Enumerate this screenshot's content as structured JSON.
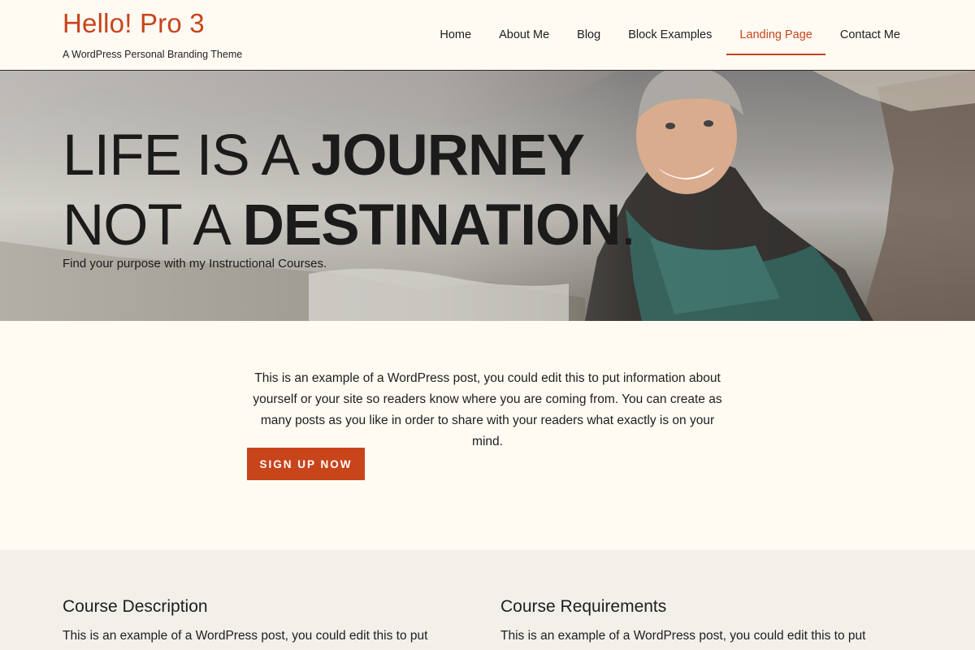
{
  "site": {
    "title": "Hello! Pro 3",
    "tagline": "A WordPress Personal Branding Theme"
  },
  "nav": {
    "items": [
      {
        "label": "Home",
        "active": false
      },
      {
        "label": "About Me",
        "active": false
      },
      {
        "label": "Blog",
        "active": false
      },
      {
        "label": "Block Examples",
        "active": false
      },
      {
        "label": "Landing Page",
        "active": true
      },
      {
        "label": "Contact Me",
        "active": false
      }
    ]
  },
  "hero": {
    "line1_light": "LIFE IS A ",
    "line1_bold": "JOURNEY",
    "line2_light": "NOT A ",
    "line2_bold": "DESTINATION",
    "line2_end": ".",
    "subtitle": "Find your purpose with my Instructional Courses."
  },
  "intro": {
    "text": "This is an example of a WordPress post, you could edit this to put information about yourself or your site so readers know where you are coming from. You can create as many posts as you like in order to share with your readers what exactly is on your mind.",
    "cta_label": "SIGN UP NOW"
  },
  "courses": [
    {
      "title": "Course Description",
      "text": "This is an example of a WordPress post, you could edit this to put"
    },
    {
      "title": "Course Requirements",
      "text": "This is an example of a WordPress post, you could edit this to put"
    }
  ],
  "colors": {
    "accent": "#c8441b",
    "background": "#fffbf3",
    "section_alt": "#f3f0ea",
    "text": "#1e1e1e"
  }
}
